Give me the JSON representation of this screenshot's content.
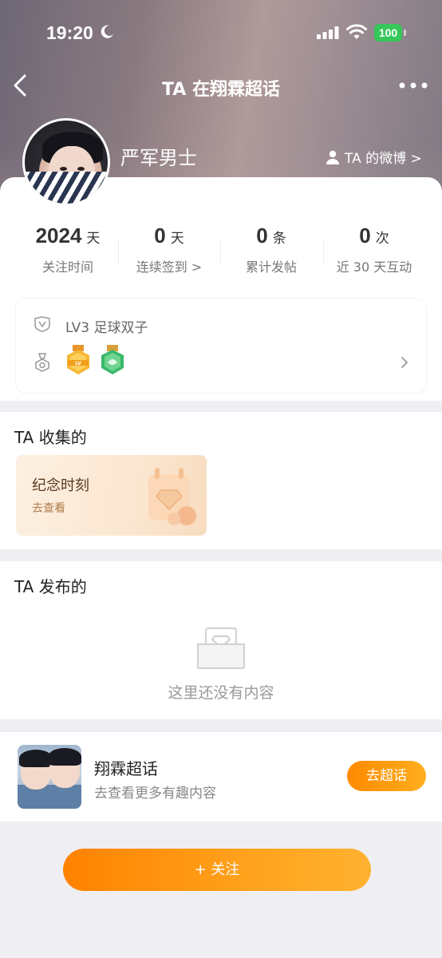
{
  "status_bar": {
    "time": "19:20",
    "battery": "100",
    "icons": [
      "moon-icon",
      "signal-icon",
      "wifi-icon",
      "battery-icon"
    ]
  },
  "nav": {
    "title": "TA 在翔霖超话",
    "back_icon": "chevron-left-icon",
    "more_icon": "more-dots-icon"
  },
  "profile": {
    "username": "严军男士",
    "weibo_link": "TA 的微博 >"
  },
  "stats": [
    {
      "num": "2024",
      "unit": "天",
      "label": "关注时间"
    },
    {
      "num": "0",
      "unit": "天",
      "label": "连续签到 >"
    },
    {
      "num": "0",
      "unit": "条",
      "label": "累计发帖"
    },
    {
      "num": "0",
      "unit": "次",
      "label": "近 30 天互动"
    }
  ],
  "level": {
    "text": "LV3  足球双子",
    "badges": [
      "level-medal-gold",
      "level-medal-green"
    ]
  },
  "collected": {
    "title": "TA 收集的",
    "card_title": "纪念时刻",
    "card_sub": "去查看"
  },
  "posted": {
    "title": "TA 发布的",
    "empty_text": "这里还没有内容"
  },
  "topic": {
    "name": "翔霖超话",
    "sub": "去查看更多有趣内容",
    "button": "去超话"
  },
  "follow_button": "+ 关注",
  "colors": {
    "accent": "#ff8a00",
    "battery_green": "#35c759",
    "badge_gold": "#f5a623",
    "badge_green": "#3ab86a"
  }
}
